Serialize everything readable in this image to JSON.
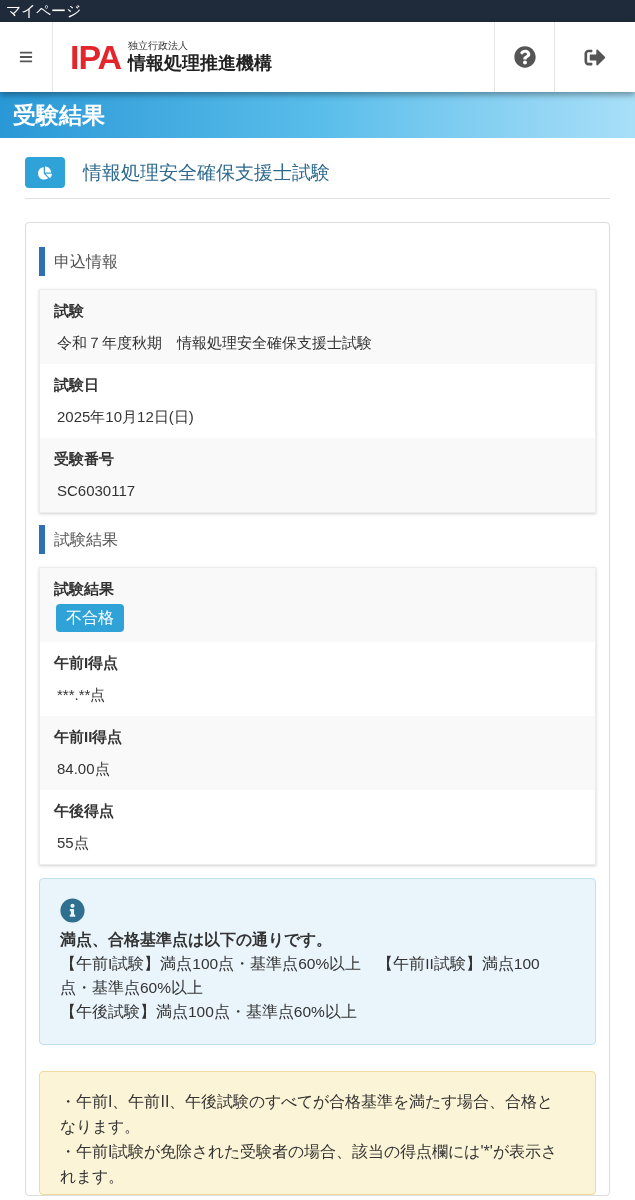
{
  "status_bar": {
    "title": "マイページ"
  },
  "header": {
    "logo": {
      "mark": "IPA",
      "subtitle": "独立行政法人",
      "name": "情報処理推進機構"
    }
  },
  "page_title": "受験結果",
  "exam_title": "情報処理安全確保支援士試験",
  "sections": [
    {
      "heading": "申込情報",
      "rows": [
        {
          "label": "試験",
          "value": "令和７年度秋期　情報処理安全確保支援士試験",
          "kind": "text"
        },
        {
          "label": "試験日",
          "value": "2025年10月12日(日)",
          "kind": "text"
        },
        {
          "label": "受験番号",
          "value": "SC6030117",
          "kind": "text"
        }
      ]
    },
    {
      "heading": "試験結果",
      "rows": [
        {
          "label": "試験結果",
          "value": "不合格",
          "kind": "badge"
        },
        {
          "label": "午前I得点",
          "value": "***.**点",
          "kind": "text"
        },
        {
          "label": "午前II得点",
          "value": "84.00点",
          "kind": "text"
        },
        {
          "label": "午後得点",
          "value": "55点",
          "kind": "text"
        }
      ]
    }
  ],
  "info_box": {
    "heading": "満点、合格基準点は以下の通りです。",
    "lines": [
      "【午前I試験】満点100点・基準点60%以上　【午前II試験】満点100点・基準点60%以上",
      "【午後試験】満点100点・基準点60%以上"
    ]
  },
  "notes": [
    "・午前I、午前II、午後試験のすべてが合格基準を満たす場合、合格となります。",
    "・午前I試験が免除された受験者の場合、該当の得点欄には'*'が表示されます。"
  ]
}
